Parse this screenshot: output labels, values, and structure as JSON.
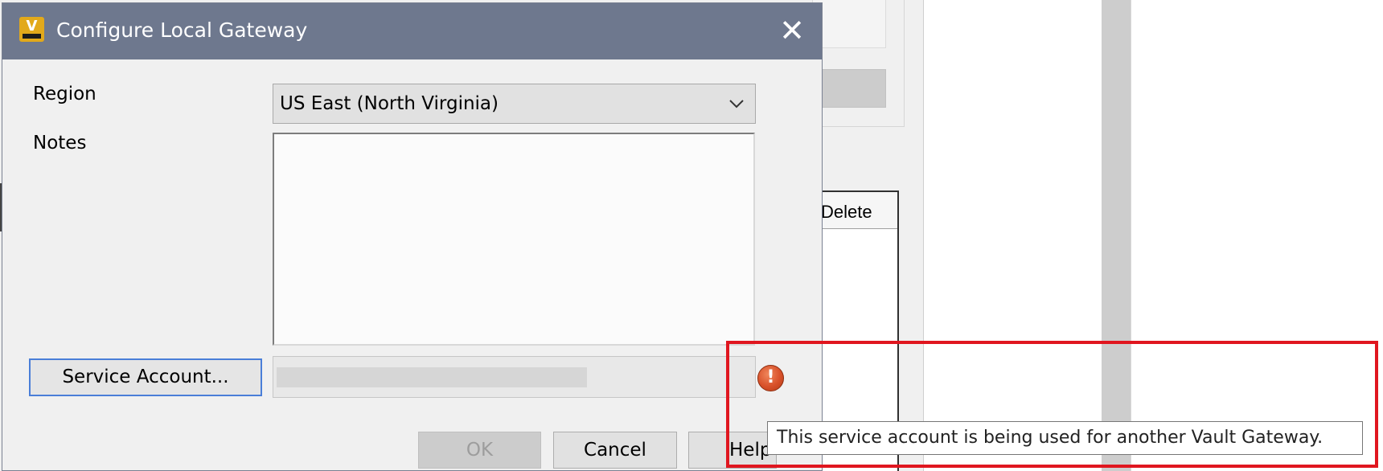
{
  "dialog": {
    "title": "Configure Local Gateway",
    "app_icon_letter": "V",
    "close_glyph": "✕"
  },
  "form": {
    "region_label": "Region",
    "region_value": "US East (North Virginia)",
    "notes_label": "Notes",
    "notes_value": "",
    "service_account_button": "Service Account...",
    "service_account_value": ""
  },
  "buttons": {
    "ok": "OK",
    "cancel": "Cancel",
    "help": "Help"
  },
  "warning": {
    "icon_glyph": "!",
    "tooltip": "This service account is being used for another Vault Gateway."
  },
  "background_window": {
    "grid_column_header": "Delete"
  },
  "colors": {
    "titlebar": "#6e788e",
    "highlight": "#e0161f",
    "focus_border": "#4a7ed8",
    "warning_icon": "#d8512a",
    "app_icon": "#e2a91b"
  }
}
